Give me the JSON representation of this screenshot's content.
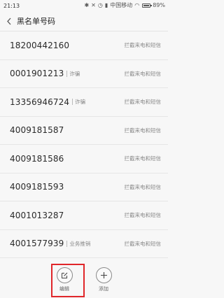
{
  "status_bar": {
    "time": "21:13",
    "carrier": "中国移动",
    "battery": "89%"
  },
  "header": {
    "title": "黑名单号码"
  },
  "blacklist": [
    {
      "number": "18200442160",
      "tag": "",
      "status": "拦截来电和短信"
    },
    {
      "number": "0001901213",
      "tag": "诈骗",
      "status": "拦截来电和短信"
    },
    {
      "number": "13356946724",
      "tag": "诈骗",
      "status": "拦截来电和短信"
    },
    {
      "number": "4009181587",
      "tag": "",
      "status": "拦截来电和短信"
    },
    {
      "number": "4009181586",
      "tag": "",
      "status": "拦截来电和短信"
    },
    {
      "number": "4009181593",
      "tag": "",
      "status": "拦截来电和短信"
    },
    {
      "number": "4001013287",
      "tag": "",
      "status": "拦截来电和短信"
    },
    {
      "number": "4001577939",
      "tag": "业务推销",
      "status": "拦截来电和短信"
    }
  ],
  "actions": {
    "edit_label": "编辑",
    "add_label": "添加"
  },
  "colors": {
    "highlight": "#e0262a"
  }
}
